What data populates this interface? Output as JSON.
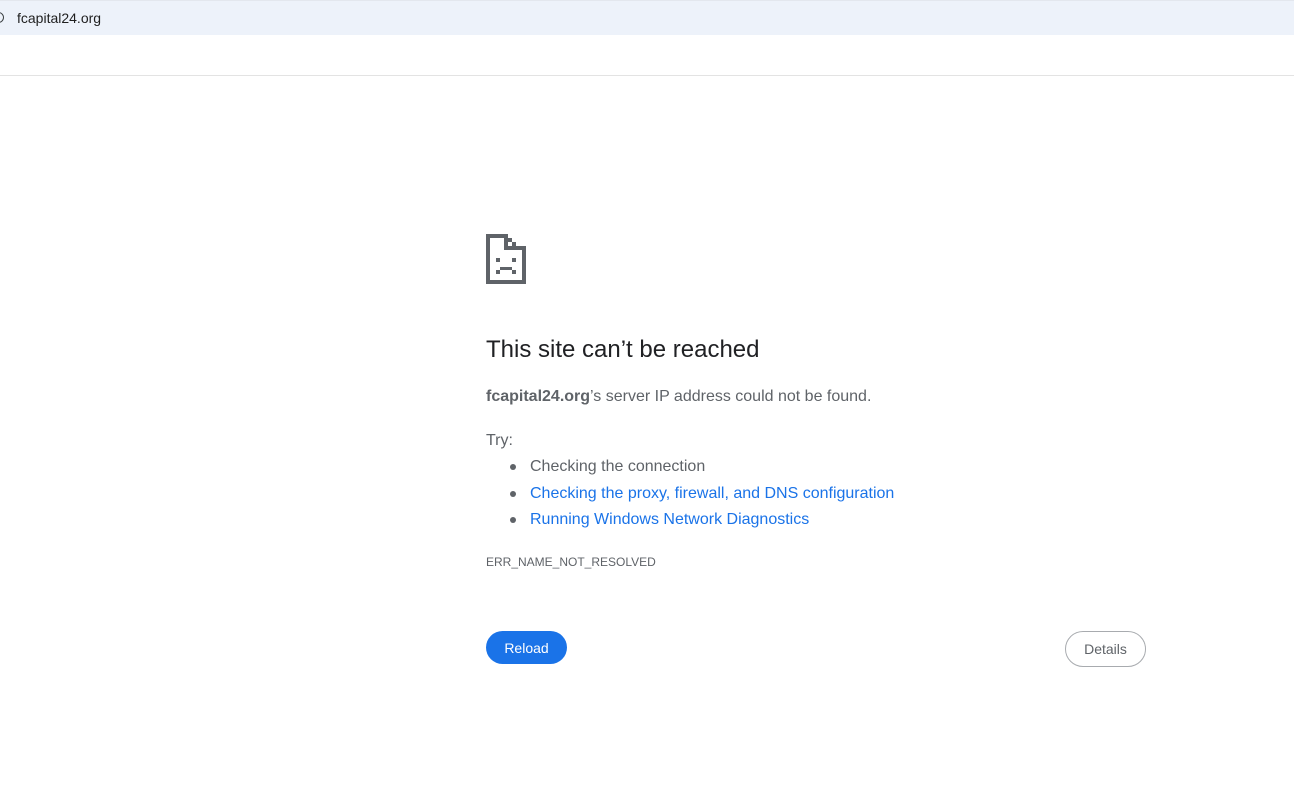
{
  "address_bar": {
    "url": "fcapital24.org"
  },
  "error_page": {
    "icon": "sad-document-icon",
    "heading": "This site can’t be reached",
    "host": "fcapital24.org",
    "message_suffix": "’s server IP address could not be found.",
    "try_label": "Try:",
    "suggestions": [
      {
        "text": "Checking the connection",
        "is_link": false
      },
      {
        "text": "Checking the proxy, firewall, and DNS configuration",
        "is_link": true
      },
      {
        "text": "Running Windows Network Diagnostics",
        "is_link": true
      }
    ],
    "error_code": "ERR_NAME_NOT_RESOLVED",
    "reload_label": "Reload",
    "details_label": "Details"
  },
  "colors": {
    "accent": "#1a73e8",
    "text_primary": "#202124",
    "text_secondary": "#5f6368",
    "address_bar_bg": "#edf2fa"
  }
}
